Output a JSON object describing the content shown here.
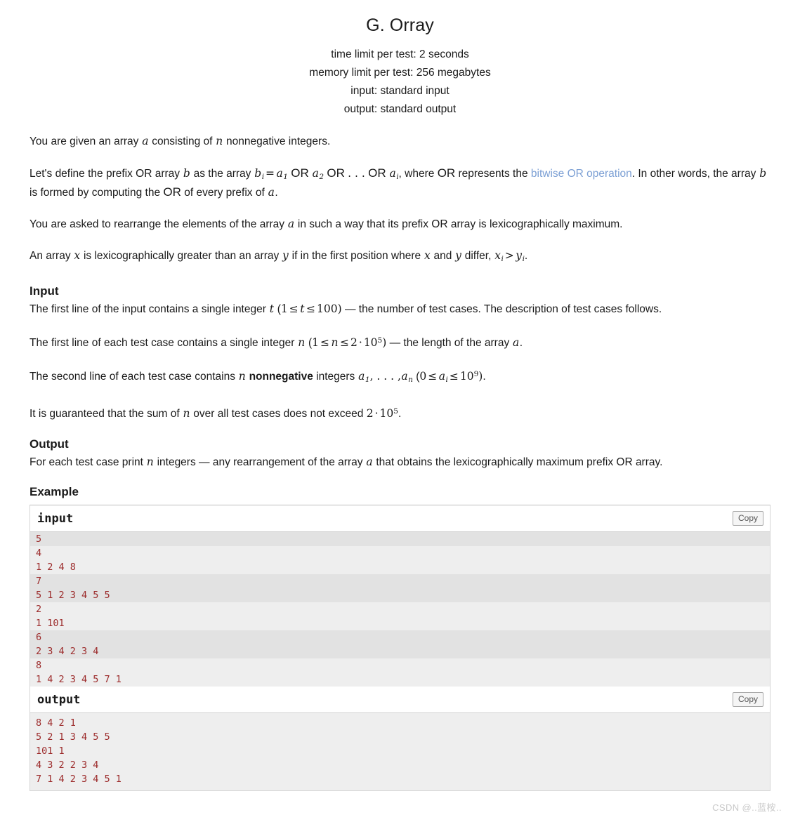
{
  "header": {
    "title": "G. Orray",
    "time_limit": "time limit per test: 2 seconds",
    "memory_limit": "memory limit per test: 256 megabytes",
    "input_spec": "input: standard input",
    "output_spec": "output: standard output"
  },
  "statement": {
    "p1_a": "You are given an array ",
    "p1_var_a": "a",
    "p1_b": " consisting of ",
    "p1_var_n": "n",
    "p1_c": " nonnegative integers.",
    "p2_a": "Let's define the prefix OR array ",
    "p2_var_b": "b",
    "p2_b": " as the array ",
    "p2_math_b": "b",
    "p2_math_b_sub": "i",
    "p2_eq": "=",
    "p2_a1": "a",
    "p2_a1_sub": "1",
    "p2_or1": "OR",
    "p2_a2": "a",
    "p2_a2_sub": "2",
    "p2_or2": "OR",
    "p2_dots": ". . .",
    "p2_or3": "OR",
    "p2_ai": "a",
    "p2_ai_sub": "i",
    "p2_c": ", where ",
    "p2_or_word": "OR",
    "p2_d": " represents the ",
    "p2_link": "bitwise OR operation",
    "p2_e": ". In other words, the array ",
    "p2_var_b2": "b",
    "p2_f": " is formed by computing the ",
    "p2_or_word2": "OR",
    "p2_g": " of every prefix of ",
    "p2_var_a2": "a",
    "p2_h": ".",
    "p3_a": "You are asked to rearrange the elements of the array ",
    "p3_var_a": "a",
    "p3_b": " in such a way that its prefix OR array is lexicographically maximum.",
    "p4_a": "An array ",
    "p4_var_x": "x",
    "p4_b": " is lexicographically greater than an array ",
    "p4_var_y": "y",
    "p4_c": " if in the first position where ",
    "p4_var_x2": "x",
    "p4_d": " and ",
    "p4_var_y2": "y",
    "p4_e": " differ, ",
    "p4_xi": "x",
    "p4_xi_sub": "i",
    "p4_gt": ">",
    "p4_yi": "y",
    "p4_yi_sub": "i",
    "p4_f": "."
  },
  "input_section": {
    "title": "Input",
    "l1_a": "The first line of the input contains a single integer ",
    "l1_t": "t",
    "l1_open": " (",
    "l1_one": "1",
    "l1_le1": "≤",
    "l1_t2": "t",
    "l1_le2": "≤",
    "l1_hundred": "100",
    "l1_close": ")",
    "l1_b": " — the number of test cases. The description of test cases follows.",
    "l2_a": "The first line of each test case contains a single integer ",
    "l2_n": "n",
    "l2_open": " (",
    "l2_one": "1",
    "l2_le1": "≤",
    "l2_n2": "n",
    "l2_le2": "≤",
    "l2_two": "2",
    "l2_cdot": "·",
    "l2_ten": "10",
    "l2_sup": "5",
    "l2_close": ")",
    "l2_b": " — the length of the array ",
    "l2_a_var": "a",
    "l2_c": ".",
    "l3_a": "The second line of each test case contains ",
    "l3_n": "n",
    "l3_bold": "nonnegative",
    "l3_b": " integers ",
    "l3_a1": "a",
    "l3_a1_sub": "1",
    "l3_comma_dots": ", . . . ,",
    "l3_an": "a",
    "l3_an_sub": "n",
    "l3_open": " (",
    "l3_zero": "0",
    "l3_le1": "≤",
    "l3_ai": "a",
    "l3_ai_sub": "i",
    "l3_le2": "≤",
    "l3_ten": "10",
    "l3_sup": "9",
    "l3_close": ")",
    "l3_c": ".",
    "l4_a": "It is guaranteed that the sum of ",
    "l4_n": "n",
    "l4_b": " over all test cases does not exceed ",
    "l4_two": "2",
    "l4_cdot": "·",
    "l4_ten": "10",
    "l4_sup": "5",
    "l4_c": "."
  },
  "output_section": {
    "title": "Output",
    "l1_a": "For each test case print ",
    "l1_n": "n",
    "l1_b": " integers — any rearrangement of the array ",
    "l1_a_var": "a",
    "l1_c": " that obtains the lexicographically maximum prefix OR array."
  },
  "example": {
    "title": "Example",
    "copy_label": "Copy",
    "input_label": "input",
    "output_label": "output",
    "input_lines": [
      "5",
      "4",
      "1 2 4 8",
      "7",
      "5 1 2 3 4 5 5",
      "2",
      "1 101",
      "6",
      "2 3 4 2 3 4",
      "8",
      "1 4 2 3 4 5 7 1"
    ],
    "input_line_shading": [
      "alt",
      "",
      "",
      "alt",
      "alt",
      "",
      "",
      "alt",
      "alt",
      "",
      ""
    ],
    "output_lines": [
      "8 4 2 1",
      "5 2 1 3 4 5 5",
      "101 1",
      "4 3 2 2 3 4",
      "7 1 4 2 3 4 5 1"
    ]
  },
  "watermark": {
    "text": "CSDN @..蓝桉.."
  },
  "colors": {
    "link": "#7b9fd4",
    "sample_text": "#9c2b2b",
    "sample_bg": "#eeeeee",
    "sample_bg_alt": "#e2e2e2"
  }
}
